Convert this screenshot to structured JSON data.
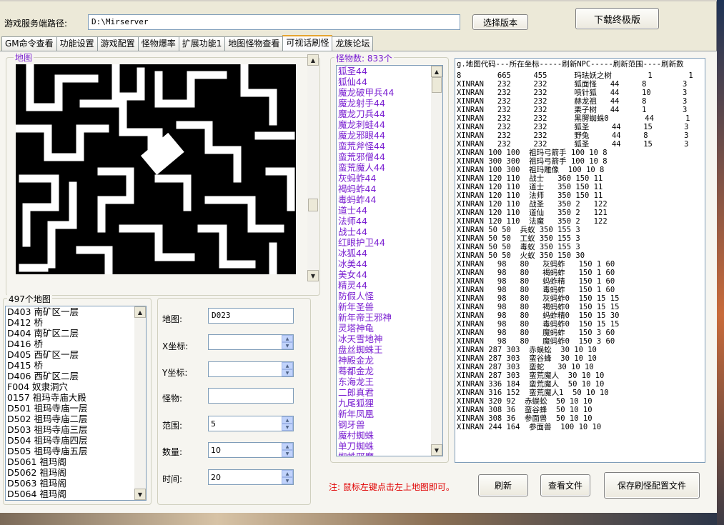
{
  "header": {
    "path_label": "游戏服务端路径:",
    "path_value": "D:\\Mirserver",
    "select_version": "选择版本",
    "download": "下载终极版"
  },
  "tabs": [
    "GM命令查看",
    "功能设置",
    "游戏配置",
    "怪物爆率",
    "扩展功能1",
    "地图怪物查看",
    "可视话刷怪",
    "龙族论坛"
  ],
  "active_tab": "可视话刷怪",
  "map_box": {
    "title": "地图"
  },
  "maps": {
    "title": "497个地图",
    "items": [
      {
        "code": "D403",
        "name": "南矿区一层"
      },
      {
        "code": "D412",
        "name": "桥"
      },
      {
        "code": "D404",
        "name": "南矿区二层"
      },
      {
        "code": "D416",
        "name": "桥"
      },
      {
        "code": "D405",
        "name": "西矿区一层"
      },
      {
        "code": "D415",
        "name": "桥"
      },
      {
        "code": "D406",
        "name": "西矿区二层"
      },
      {
        "code": "F004",
        "name": "奴隶洞穴"
      },
      {
        "code": "0157",
        "name": "祖玛寺庙大殿"
      },
      {
        "code": "D501",
        "name": "祖玛寺庙一层"
      },
      {
        "code": "D502",
        "name": "祖玛寺庙二层"
      },
      {
        "code": "D503",
        "name": "祖玛寺庙三层"
      },
      {
        "code": "D504",
        "name": "祖玛寺庙四层"
      },
      {
        "code": "D505",
        "name": "祖玛寺庙五层"
      },
      {
        "code": "D5061",
        "name": "祖玛阁"
      },
      {
        "code": "D5062",
        "name": "祖玛阁"
      },
      {
        "code": "D5063",
        "name": "祖玛阁"
      },
      {
        "code": "D5064",
        "name": "祖玛阁"
      }
    ]
  },
  "form": {
    "map_label": "地图:",
    "map_value": "D023",
    "x_label": "X坐标:",
    "x_value": "",
    "y_label": "Y坐标:",
    "y_value": "",
    "monster_label": "怪物:",
    "monster_value": "",
    "range_label": "范围:",
    "range_value": "5",
    "count_label": "数量:",
    "count_value": "10",
    "time_label": "时间:",
    "time_value": "20"
  },
  "monsters": {
    "title": "怪物数: 833个",
    "items": [
      "狐圣44",
      "狐仙44",
      "魔龙破甲兵44",
      "魔龙射手44",
      "魔龙刀兵44",
      "魔龙刺蛙44",
      "魔龙邪眼44",
      "蛮荒斧怪44",
      "蛮荒邪僧44",
      "蛮荒魔人44",
      "灰蚂蚱44",
      "褐蚂蚱44",
      "毒蚂蚱44",
      "道士44",
      "法师44",
      "战士44",
      "红眼护卫44",
      "冰狐44",
      "冰美44",
      "美女44",
      "精灵44",
      "防假人怪",
      "新年圣兽",
      "新年帝王邪神",
      "灵塔神龟",
      "冰天雪地神",
      "盘丝蜘蛛王",
      "神殿金龙",
      "蓦都金龙",
      "东海龙王",
      "二郎真君",
      "九尾狐狸",
      "新年凤凰",
      "钢牙兽",
      "魔村蜘蛛",
      "单刀蜘蛛",
      "蜘蛛邪魔"
    ]
  },
  "config": {
    "header": "g.地图代码---所在坐标-----刷新NPC-----刷新范围----刷新数",
    "lines": [
      "8        665     455      玛珐妖之树        1        1",
      "XINRAN   232     232      狐面怪   44     8        3",
      "XINRAN   232     232      喷针狐   44     10       3",
      "XINRAN   232     232      赫龙祖   44     8        3",
      "XINRAN   232     232      栗子树   44     1        3",
      "XINRAN   232     232      黑腭蜘蛛0        44       1",
      "XINRAN   232     232      狐圣     44     15       3",
      "XINRAN   232     232      野兔     44     8        3",
      "XINRAN   232     232      狐圣     44     15       3",
      "XINRAN 100 100  祖玛弓箭手 100 10 8",
      "XINRAN 300 300  祖玛弓箭手 100 10 8",
      "XINRAN 100 300  祖玛雕像  100 10 8",
      "XINRAN 120 110  战士   360 150 11",
      "XINRAN 120 110  道士   350 150 11",
      "XINRAN 120 110  法师   350 150 11",
      "XINRAN 120 110  战圣   350 2   122",
      "XINRAN 120 110  道仙   350 2   121",
      "XINRAN 120 110  法魔   350 2   122",
      "XINRAN 50 50  兵蚁 350 155 3",
      "XINRAN 50 50  工蚁 350 155 3",
      "XINRAN 50 50  毒蚁 350 155 3",
      "XINRAN 50 50  火蚁 350 150 30",
      "XINRAN   98   80   灰蚂蚱   150 1 60",
      "XINRAN   98   80   褐蚂蚱   150 1 60",
      "XINRAN   98   80   蚂蚱精   150 1 60",
      "XINRAN   98   80   毒蚂蚱   150 1 60",
      "XINRAN   98   80   灰蚂蚱0  150 15 15",
      "XINRAN   98   80   褐蚂蚱0  150 15 15",
      "XINRAN   98   80   蚂蚱精0  150 15 30",
      "XINRAN   98   80   毒蚂蚱0  150 15 15",
      "XINRAN   98   80   魔蚂蚱   150 3 60",
      "XINRAN   98   80   魔蚂蚱0  150 3 60",
      "XINRAN 287 303  赤蜈蚣  30 10 10",
      "XINRAN 287 303  蛮谷蜂  30 10 10",
      "XINRAN 287 303  蛮蛇   30 10 10",
      "XINRAN 287 303  蛮荒魔人  30 10 10",
      "XINRAN 336 184  蛮荒魔人  50 10 10",
      "XINRAN 316 152  蛮荒魔人1  50 10 10",
      "XINRAN 320 92  赤蜈蚣  50 10 10",
      "XINRAN 308 36  蛮谷蜂  50 10 10",
      "XINRAN 308 36  参面兽  50 10 10",
      "XINRAN 244 164  参面兽  100 10 10"
    ]
  },
  "footer": {
    "hint": "注: 鼠标左键点击左上地图即可。",
    "refresh": "刷新",
    "view_file": "查看文件",
    "save": "保存刷怪配置文件"
  },
  "colors": {
    "monster_text": "#7a1fd1",
    "hint_text": "#e00000",
    "accent_tab": "#e6a42e"
  }
}
